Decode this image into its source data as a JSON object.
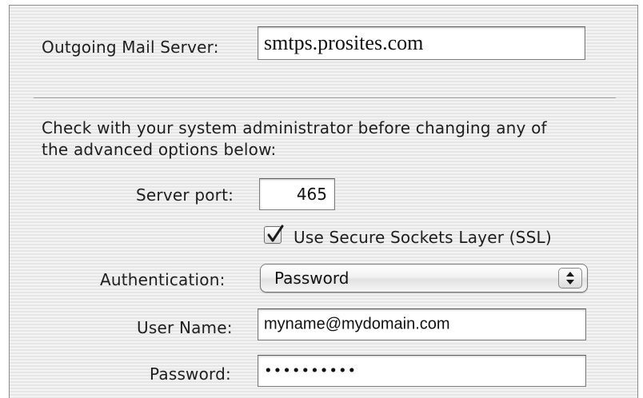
{
  "outgoing_server": {
    "label": "Outgoing Mail Server:",
    "value": "smtps.prosites.com"
  },
  "advanced_notice": {
    "line1": "Check with your system administrator before changing any of",
    "line2": "the advanced options below:"
  },
  "server_port": {
    "label": "Server port:",
    "value": "465"
  },
  "ssl": {
    "label": "Use Secure Sockets Layer (SSL)",
    "checked": true
  },
  "authentication": {
    "label": "Authentication:",
    "value": "Password",
    "icon": "up-down-arrows-icon"
  },
  "user_name": {
    "label": "User Name:",
    "value": "myname@mydomain.com"
  },
  "password": {
    "label": "Password:",
    "value": "••••••••••"
  },
  "colors": {
    "panel_background": "#ececec",
    "field_border": "#7d7d7d",
    "text": "#1e1e1e"
  }
}
